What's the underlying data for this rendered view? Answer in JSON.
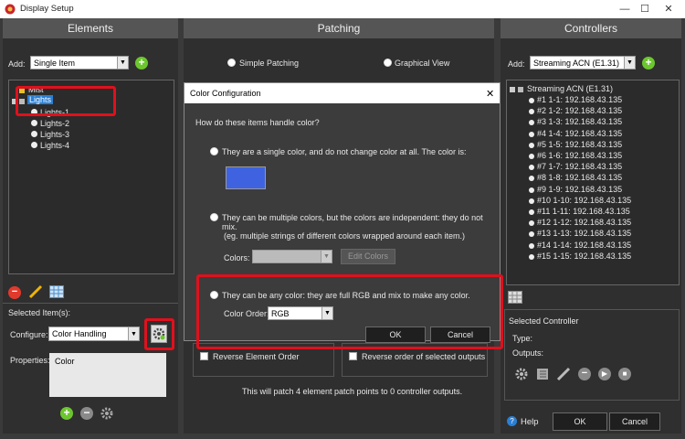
{
  "window": {
    "title": "Display Setup",
    "minimize": "—",
    "maximize": "☐",
    "close": "✕"
  },
  "elements": {
    "header": "Elements",
    "add_label": "Add:",
    "add_value": "Single Item",
    "tree": [
      {
        "label": "Mist",
        "level": 0
      },
      {
        "label": "Lights",
        "level": 0,
        "selected": true
      },
      {
        "label": "Lights-1",
        "level": 1
      },
      {
        "label": "Lights-2",
        "level": 1
      },
      {
        "label": "Lights-3",
        "level": 1
      },
      {
        "label": "Lights-4",
        "level": 1
      }
    ],
    "selected_items_label": "Selected Item(s):",
    "configure_label": "Configure:",
    "configure_value": "Color Handling",
    "properties_label": "Properties:",
    "properties_value": "Color"
  },
  "patching": {
    "header": "Patching",
    "simple": "Simple Patching",
    "graphical": "Graphical View",
    "reverse_element": "Reverse Element Order",
    "reverse_outputs": "Reverse order of selected outputs",
    "status": "This will patch 4 element patch points to 0 controller outputs."
  },
  "controllers": {
    "header": "Controllers",
    "add_label": "Add:",
    "add_value": "Streaming ACN (E1.31)",
    "root": "Streaming ACN (E1.31)",
    "items": [
      "#1 1-1: 192.168.43.135",
      "#2 1-2: 192.168.43.135",
      "#3 1-3: 192.168.43.135",
      "#4 1-4: 192.168.43.135",
      "#5 1-5: 192.168.43.135",
      "#6 1-6: 192.168.43.135",
      "#7 1-7: 192.168.43.135",
      "#8 1-8: 192.168.43.135",
      "#9 1-9: 192.168.43.135",
      "#10 1-10: 192.168.43.135",
      "#11 1-11: 192.168.43.135",
      "#12 1-12: 192.168.43.135",
      "#13 1-13: 192.168.43.135",
      "#14 1-14: 192.168.43.135",
      "#15 1-15: 192.168.43.135"
    ],
    "selected_label": "Selected Controller",
    "type_label": "Type:",
    "outputs_label": "Outputs:"
  },
  "dialog": {
    "title": "Color Configuration",
    "close": "✕",
    "question": "How do these items handle color?",
    "option1": "They are a single color, and do not change color at all. The color is:",
    "swatch_color": "#3f63e0",
    "option2": "They can be multiple colors, but the colors are independent: they do not mix.",
    "option2_note": "(eg. multiple strings of different colors wrapped around each item.)",
    "colors_label": "Colors:",
    "edit_colors": "Edit Colors",
    "option3": "They can be any color: they are full RGB and mix to make any color.",
    "color_order_label": "Color Order:",
    "color_order_value": "RGB",
    "ok": "OK",
    "cancel": "Cancel"
  },
  "footer": {
    "help": "Help",
    "ok": "OK",
    "cancel": "Cancel"
  },
  "colors": {
    "highlight": "#e0101c",
    "accent_green": "#6cc62e",
    "selection": "#2a7fd4"
  }
}
